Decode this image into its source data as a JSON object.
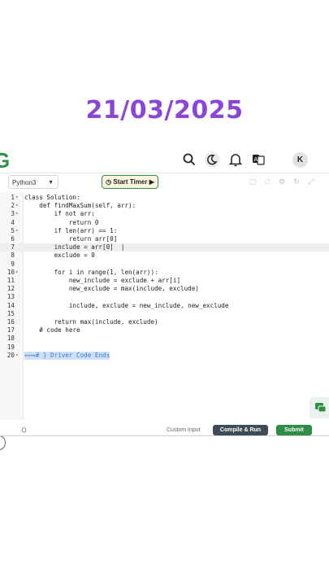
{
  "overlay": {
    "date": "21/03/2025"
  },
  "header": {
    "logo": "G",
    "avatar_initial": "K",
    "icons": [
      "search-icon",
      "moon-icon",
      "bell-icon",
      "translate-icon"
    ]
  },
  "toolbar": {
    "language": "Python3",
    "timer_label": "Start Timer",
    "icons": [
      "copy-icon",
      "paste-icon",
      "settings-icon",
      "refresh-icon",
      "fullscreen-icon"
    ]
  },
  "editor": {
    "lines": [
      {
        "n": "1",
        "fold": true,
        "text": "class Solution:"
      },
      {
        "n": "2",
        "fold": true,
        "text": "    def findMaxSum(self, arr):"
      },
      {
        "n": "3",
        "fold": true,
        "text": "        if not arr:"
      },
      {
        "n": "4",
        "fold": false,
        "text": "            return 0"
      },
      {
        "n": "5",
        "fold": true,
        "text": "        if len(arr) == 1:"
      },
      {
        "n": "6",
        "fold": false,
        "text": "            return arr[0]"
      },
      {
        "n": "7",
        "fold": false,
        "text": "        include = arr[0]  |"
      },
      {
        "n": "8",
        "fold": false,
        "text": "        exclude = 0"
      },
      {
        "n": "9",
        "fold": false,
        "text": ""
      },
      {
        "n": "10",
        "fold": true,
        "text": "        for i in range(1, len(arr)):"
      },
      {
        "n": "11",
        "fold": false,
        "text": "            new_include = exclude + arr[i]"
      },
      {
        "n": "12",
        "fold": false,
        "text": "            new_exclude = max(include, exclude)"
      },
      {
        "n": "13",
        "fold": false,
        "text": ""
      },
      {
        "n": "14",
        "fold": false,
        "text": "            include, exclude = new_include, new_exclude"
      },
      {
        "n": "15",
        "fold": false,
        "text": ""
      },
      {
        "n": "16",
        "fold": false,
        "text": "        return max(include, exclude)"
      },
      {
        "n": "17",
        "fold": false,
        "text": "    # code here"
      },
      {
        "n": "18",
        "fold": false,
        "text": ""
      },
      {
        "n": "19",
        "fold": false,
        "text": ""
      },
      {
        "n": "20",
        "fold": true,
        "text": "↔↔↔# } Driver Code Ends"
      }
    ],
    "highlighted_line": 7,
    "selected_line": 20
  },
  "footer": {
    "custom_input": "Custom Input",
    "compile_run": "Compile & Run",
    "submit": "Submit"
  },
  "colors": {
    "date": "#8a45d9",
    "brand": "#2f8d46",
    "compile_bg": "#3f4b56"
  }
}
